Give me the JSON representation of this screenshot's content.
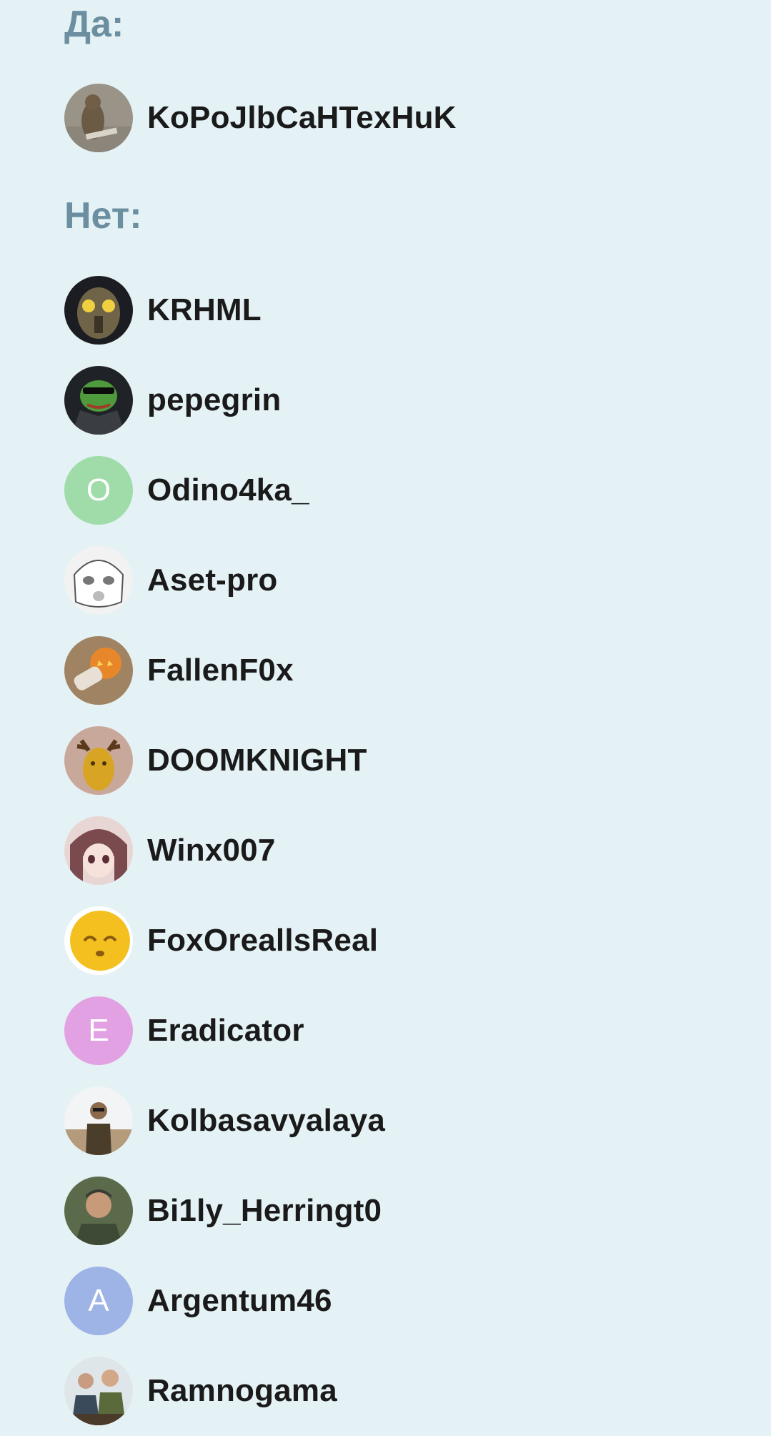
{
  "sections": {
    "yes": {
      "title": "Да:",
      "users": [
        {
          "name": "KoPoJlbCaHTexHuK",
          "avatar": "marmot-photo-avatar"
        }
      ]
    },
    "no": {
      "title": "Нет:",
      "users": [
        {
          "name": "KRHML",
          "avatar": "power-armor-helmet-avatar"
        },
        {
          "name": "pepegrin",
          "avatar": "pepe-frog-avatar"
        },
        {
          "name": "Odino4ka_",
          "avatar": "letter-avatar",
          "initial": "O",
          "color": "#9fdcaa"
        },
        {
          "name": "Aset-pro",
          "avatar": "anime-sketch-avatar"
        },
        {
          "name": "FallenF0x",
          "avatar": "pumpkin-avatar"
        },
        {
          "name": "DOOMKNIGHT",
          "avatar": "golden-moose-figure-avatar"
        },
        {
          "name": "Winx007",
          "avatar": "anime-girl-avatar"
        },
        {
          "name": "FoxOreallsReal",
          "avatar": "emoji-face-avatar"
        },
        {
          "name": "Eradicator",
          "avatar": "letter-avatar",
          "initial": "E",
          "color": "#e2a1e3"
        },
        {
          "name": "Kolbasavyalaya",
          "avatar": "desert-man-photo-avatar"
        },
        {
          "name": "Bi1ly_Herringt0",
          "avatar": "man-portrait-photo-avatar"
        },
        {
          "name": "Argentum46",
          "avatar": "letter-avatar",
          "initial": "A",
          "color": "#9eb3e6"
        },
        {
          "name": "Ramnogama",
          "avatar": "group-photo-avatar"
        }
      ]
    }
  },
  "colors": {
    "background": "#e4f1f5",
    "section_title": "#6b8fa0",
    "username": "#1a1a1a"
  }
}
